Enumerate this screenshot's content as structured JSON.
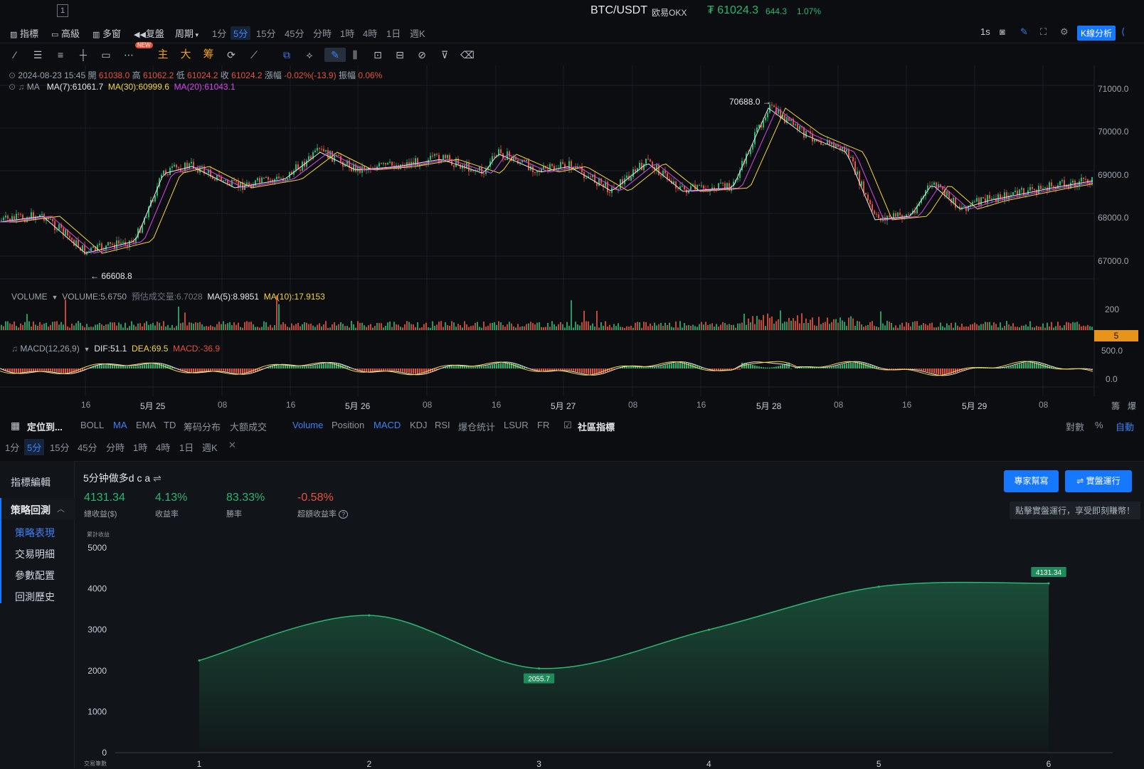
{
  "topbar": {
    "index": "1",
    "symbol": "BTC/USDT",
    "exchange": "欧易OKX",
    "price": "₮ 61024.3",
    "change": "644.3",
    "change_pct": "1.07%"
  },
  "toolbar": {
    "indicator": "指標",
    "advanced": "高級",
    "multi": "多窗",
    "replay": "复盤",
    "period": "周期",
    "periods": [
      "1分",
      "5分",
      "15分",
      "45分",
      "分時",
      "1時",
      "4時",
      "1日",
      "週K"
    ],
    "active_period": "5分",
    "refresh": "1s",
    "k_analysis": "K線分析"
  },
  "drawtools": {
    "new_badge": "NEW",
    "main": "主",
    "big": "大",
    "chip": "筹"
  },
  "ohlc": {
    "datetime": "2024-08-23 15:45",
    "open_label": "開",
    "open": "61038.0",
    "high_label": "高",
    "high": "61062.2",
    "low_label": "低",
    "low": "61024.2",
    "close_label": "收",
    "close": "61024.2",
    "change_label": "漲幅",
    "change": "-0.02%(-13.9)",
    "amp_label": "振幅",
    "amp": "0.06%"
  },
  "ma": {
    "label": "MA",
    "ma7": "MA(7):61061.7",
    "ma30": "MA(30):60999.6",
    "ma20": "MA(20):61043.1"
  },
  "price_axis": [
    "71000.0",
    "70000.0",
    "69000.0",
    "68000.0",
    "67000.0"
  ],
  "price_markers": {
    "high": "70688.0",
    "low": "66608.8"
  },
  "volume": {
    "label": "VOLUME",
    "value": "VOLUME:5.6750",
    "est": "預估成交量:6.7028",
    "ma5": "MA(5):8.9851",
    "ma10": "MA(10):17.9153",
    "axis_top": "200",
    "current": "5"
  },
  "macd": {
    "label": "MACD(12,26,9)",
    "dif": "DIF:51.1",
    "dea": "DEA:69.5",
    "macd": "MACD:-36.9",
    "axis": [
      "500.0",
      "0.0"
    ]
  },
  "time_axis": [
    "16",
    "5月 25",
    "08",
    "16",
    "5月 26",
    "08",
    "16",
    "5月 27",
    "08",
    "16",
    "5月 28",
    "08",
    "16",
    "5月 29",
    "08"
  ],
  "time_axis_right": [
    "籌",
    "爆"
  ],
  "indicators": {
    "locate": "定位到...",
    "main_list": [
      "BOLL",
      "MA",
      "EMA",
      "TD",
      "筹码分布",
      "大额成交"
    ],
    "main_active": "MA",
    "sub_list": [
      "Volume",
      "Position",
      "MACD",
      "KDJ",
      "RSI",
      "爆仓统计",
      "LSUR",
      "FR"
    ],
    "community": "社區指標",
    "right": [
      "對數",
      "%",
      "自動"
    ]
  },
  "timeframes": [
    "1分",
    "5分",
    "15分",
    "45分",
    "分時",
    "1時",
    "4時",
    "1日",
    "週K"
  ],
  "sidebar": {
    "edit": "指標編輯",
    "backtest": "策略回測",
    "items": [
      "策略表現",
      "交易明細",
      "參數配置",
      "回測歷史"
    ]
  },
  "strategy": {
    "name": "5分钟做多d c a",
    "stats": [
      {
        "value": "4131.34",
        "label": "總收益($)",
        "color": "#2bb673"
      },
      {
        "value": "4.13%",
        "label": "收益率",
        "color": "#2bb673"
      },
      {
        "value": "83.33%",
        "label": "勝率",
        "color": "#2bb673"
      },
      {
        "value": "-0.58%",
        "label": "超額收益率",
        "color": "#e5533d"
      }
    ],
    "expert_button": "專家幫寫",
    "live_button": "⇌ 實盤運行",
    "hint": "點擊實盤運行，享受即刻賺幣！"
  },
  "chart_data": {
    "type": "area",
    "ylabel": "累計收益",
    "xlabel": "交易筆數",
    "x": [
      1,
      2,
      3,
      4,
      5,
      6
    ],
    "values": [
      2250,
      3350,
      2055.7,
      3000,
      4050,
      4131.34
    ],
    "ylim": [
      0,
      5000
    ],
    "yticks": [
      "5000",
      "4000",
      "3000",
      "2000",
      "1000",
      "0"
    ],
    "xticks": [
      "1",
      "2",
      "3",
      "4",
      "5",
      "6"
    ],
    "min_label": "2055.7",
    "end_label": "4131.34",
    "color": "#2bb673"
  }
}
